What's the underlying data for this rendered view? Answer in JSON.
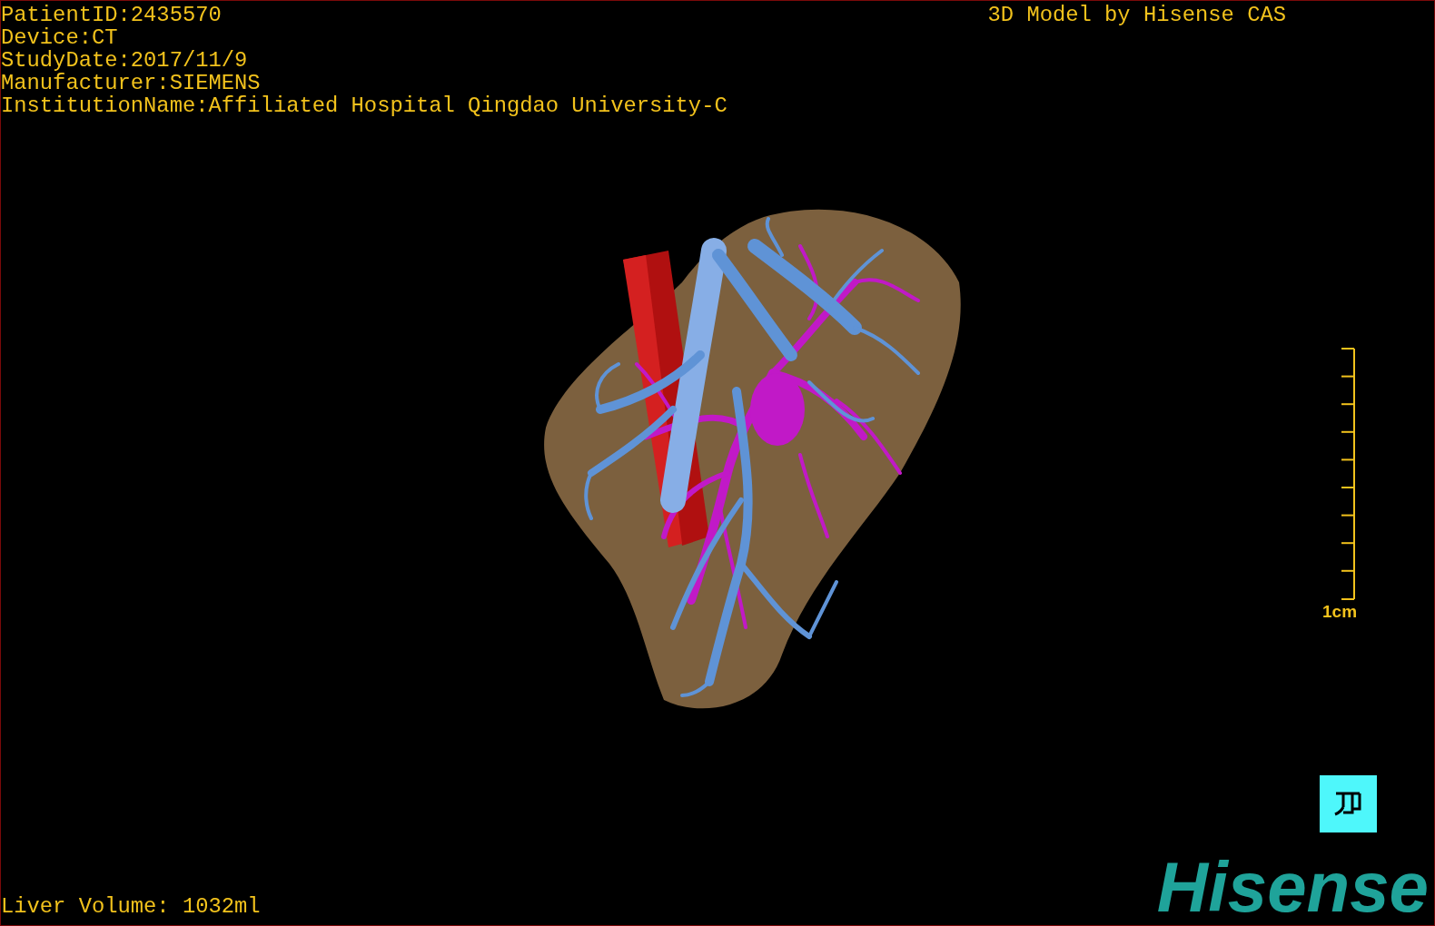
{
  "study_info": [
    "PatientID:2435570",
    "Device:CT",
    "StudyDate:2017/11/9",
    "Manufacturer:SIEMENS",
    "InstitutionName:Affiliated Hospital Qingdao University-C"
  ],
  "model_credit": "3D Model by Hisense CAS",
  "scale_bar": {
    "label": "1cm"
  },
  "liver_volume": "Liver Volume: 1032ml",
  "logo": "Hisense"
}
